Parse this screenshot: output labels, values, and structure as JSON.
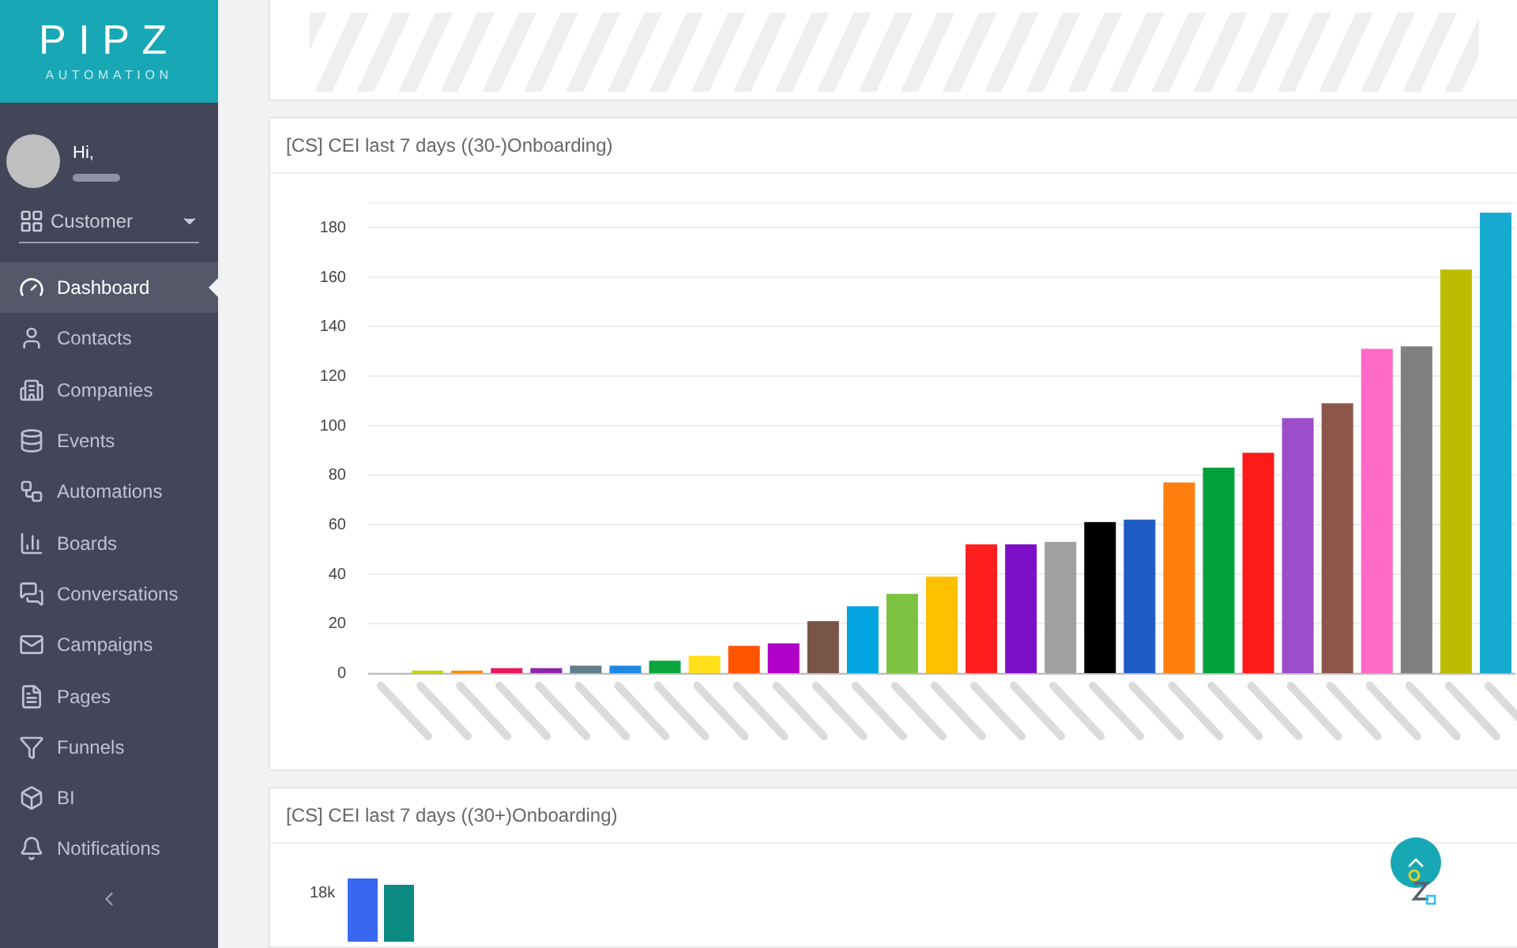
{
  "logo": {
    "name": "PIPZ",
    "tagline": "AUTOMATION"
  },
  "user": {
    "greeting": "Hi,"
  },
  "account_select": {
    "value": "Customer"
  },
  "sidebar": {
    "items": [
      {
        "label": "Dashboard",
        "selected": true
      },
      {
        "label": "Contacts",
        "selected": false
      },
      {
        "label": "Companies",
        "selected": false
      },
      {
        "label": "Events",
        "selected": false
      },
      {
        "label": "Automations",
        "selected": false
      },
      {
        "label": "Boards",
        "selected": false
      },
      {
        "label": "Conversations",
        "selected": false
      },
      {
        "label": "Campaigns",
        "selected": false
      },
      {
        "label": "Pages",
        "selected": false
      },
      {
        "label": "Funnels",
        "selected": false
      },
      {
        "label": "BI",
        "selected": false
      },
      {
        "label": "Notifications",
        "selected": false
      }
    ]
  },
  "charts": [
    {
      "title": "[CS] CEI last 7 days ((30-)Onboarding)",
      "chart_data": {
        "type": "bar",
        "grid": true,
        "ylim": [
          0,
          190
        ],
        "yticks": [
          0,
          20,
          40,
          60,
          80,
          100,
          120,
          140,
          160,
          180
        ],
        "values": [
          0,
          1,
          1,
          2,
          2,
          3,
          3,
          5,
          7,
          11,
          12,
          21,
          27,
          32,
          39,
          52,
          52,
          53,
          61,
          62,
          77,
          83,
          89,
          103,
          109,
          131,
          132,
          163,
          186
        ]
      }
    },
    {
      "title": "[CS] CEI last 7 days ((30+)Onboarding)",
      "tick": "18k"
    }
  ]
}
